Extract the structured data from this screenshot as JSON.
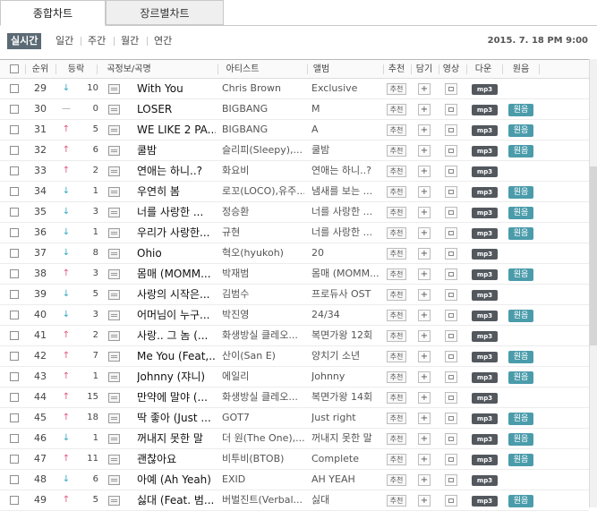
{
  "tabs": [
    {
      "label": "종합차트",
      "active": true
    },
    {
      "label": "장르별차트",
      "active": false
    }
  ],
  "periods": {
    "active": "실시간",
    "others": [
      "일간",
      "주간",
      "월간",
      "연간"
    ]
  },
  "timestamp": "2015. 7. 18 PM 9:00",
  "columns": {
    "rank": "순위",
    "change": "등락",
    "song": "곡정보/곡명",
    "artist": "아티스트",
    "album": "앨범",
    "recommend": "추천",
    "add": "담기",
    "video": "영상",
    "download": "다운",
    "original": "원음"
  },
  "buttons": {
    "recommend": "추천",
    "add": "+",
    "mp3": "mp3",
    "original": "원음"
  },
  "rows": [
    {
      "rank": "29",
      "dir": "down",
      "change": "10",
      "title": "With You",
      "artist": "Chris Brown",
      "album": "Exclusive",
      "original": false
    },
    {
      "rank": "30",
      "dir": "same",
      "change": "0",
      "title": "LOSER",
      "artist": "BIGBANG",
      "album": "M",
      "original": true
    },
    {
      "rank": "31",
      "dir": "up",
      "change": "5",
      "title": "WE LIKE 2 PA...",
      "artist": "BIGBANG",
      "album": "A",
      "original": true
    },
    {
      "rank": "32",
      "dir": "up",
      "change": "6",
      "title": "쿨밤",
      "artist": "슬리피(Sleepy),...",
      "album": "쿨밤",
      "original": true
    },
    {
      "rank": "33",
      "dir": "up",
      "change": "2",
      "title": "연애는 하니..?",
      "artist": "화요비",
      "album": "연애는 하니..?",
      "original": false
    },
    {
      "rank": "34",
      "dir": "down",
      "change": "1",
      "title": "우연히 봄",
      "artist": "로꼬(LOCO),유주...",
      "album": "냄새를 보는 ...",
      "original": true
    },
    {
      "rank": "35",
      "dir": "down",
      "change": "3",
      "title": "너를 사랑한 ...",
      "artist": "정승환",
      "album": "너를 사랑한 ...",
      "original": true
    },
    {
      "rank": "36",
      "dir": "down",
      "change": "1",
      "title": "우리가 사랑한...",
      "artist": "규현",
      "album": "너를 사랑한 ...",
      "original": true
    },
    {
      "rank": "37",
      "dir": "down",
      "change": "8",
      "title": "Ohio",
      "artist": "혁오(hyukoh)",
      "album": "20",
      "original": false
    },
    {
      "rank": "38",
      "dir": "up",
      "change": "3",
      "title": "몸매 (MOMM...",
      "artist": "박재범",
      "album": "몸매 (MOMM...",
      "original": true
    },
    {
      "rank": "39",
      "dir": "down",
      "change": "5",
      "title": "사랑의 시작은...",
      "artist": "김범수",
      "album": "프로듀사 OST",
      "original": false
    },
    {
      "rank": "40",
      "dir": "down",
      "change": "3",
      "title": "어머님이 누구...",
      "artist": "박진영",
      "album": "24/34",
      "original": true
    },
    {
      "rank": "41",
      "dir": "up",
      "change": "2",
      "title": "사랑.. 그 놈 (...",
      "artist": "화생방실 클레오...",
      "album": "복면가왕 12회",
      "original": false
    },
    {
      "rank": "42",
      "dir": "up",
      "change": "7",
      "title": "Me You (Feat,...",
      "artist": "산이(San E)",
      "album": "양치기 소년",
      "original": true
    },
    {
      "rank": "43",
      "dir": "up",
      "change": "1",
      "title": "Johnny (쟈니)",
      "artist": "에일리",
      "album": "Johnny",
      "original": true
    },
    {
      "rank": "44",
      "dir": "up",
      "change": "15",
      "title": "만약에 말야 (...",
      "artist": "화생방실 클레오...",
      "album": "복면가왕 14회",
      "original": false
    },
    {
      "rank": "45",
      "dir": "up",
      "change": "18",
      "title": "딱 좋아 (Just ...",
      "artist": "GOT7",
      "album": "Just right",
      "original": true
    },
    {
      "rank": "46",
      "dir": "down",
      "change": "1",
      "title": "꺼내지 못한 말",
      "artist": "더 원(The One),...",
      "album": "꺼내지 못한 말",
      "original": true
    },
    {
      "rank": "47",
      "dir": "up",
      "change": "11",
      "title": "괜찮아요",
      "artist": "비투비(BTOB)",
      "album": "Complete",
      "original": true
    },
    {
      "rank": "48",
      "dir": "down",
      "change": "6",
      "title": "아예 (Ah Yeah)",
      "artist": "EXID",
      "album": "AH YEAH",
      "original": false
    },
    {
      "rank": "49",
      "dir": "up",
      "change": "5",
      "title": "싫대 (Feat. 범...",
      "artist": "버벌진트(Verbal...",
      "album": "싫대",
      "original": true
    }
  ]
}
